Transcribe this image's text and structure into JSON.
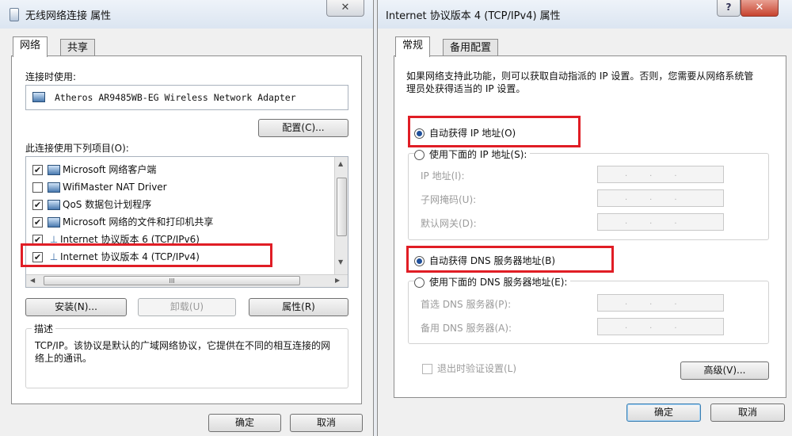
{
  "left_dialog": {
    "title": "无线网络连接 属性",
    "close": "✕",
    "tabs": [
      "网络",
      "共享"
    ],
    "connect_using_label": "连接时使用:",
    "adapter": "Atheros AR9485WB-EG Wireless Network Adapter",
    "configure_button": "配置(C)...",
    "items_label": "此连接使用下列项目(O):",
    "items": [
      {
        "label": "Microsoft 网络客户端",
        "checked": true
      },
      {
        "label": "WifiMaster NAT Driver",
        "checked": false
      },
      {
        "label": "QoS 数据包计划程序",
        "checked": true
      },
      {
        "label": "Microsoft 网络的文件和打印机共享",
        "checked": true
      },
      {
        "label": "Internet 协议版本 6 (TCP/IPv6)",
        "checked": true
      },
      {
        "label": "Internet 协议版本 4 (TCP/IPv4)",
        "checked": true
      }
    ],
    "check_mark": "✔",
    "scroll_grip": "III",
    "install_button": "安装(N)...",
    "uninstall_button": "卸载(U)",
    "properties_button": "属性(R)",
    "description_label": "描述",
    "description_text": "TCP/IP。该协议是默认的广域网络协议，它提供在不同的相互连接的网络上的通讯。",
    "ok_button": "确定",
    "cancel_button": "取消"
  },
  "right_dialog": {
    "title": "Internet 协议版本 4 (TCP/IPv4) 属性",
    "help": "?",
    "close": "✕",
    "tabs": [
      "常规",
      "备用配置"
    ],
    "intro_text": "如果网络支持此功能，则可以获取自动指派的 IP 设置。否则，您需要从网络系统管理员处获得适当的 IP 设置。",
    "auto_ip_option": "自动获得 IP 地址(O)",
    "manual_ip_option": "使用下面的 IP 地址(S):",
    "ip_address_label": "IP 地址(I):",
    "subnet_mask_label": "子网掩码(U):",
    "gateway_label": "默认网关(D):",
    "auto_dns_option": "自动获得 DNS 服务器地址(B)",
    "manual_dns_option": "使用下面的 DNS 服务器地址(E):",
    "preferred_dns_label": "首选 DNS 服务器(P):",
    "alternate_dns_label": "备用 DNS 服务器(A):",
    "ip_placeholder": "...",
    "validate_label": "退出时验证设置(L)",
    "advanced_button": "高级(V)...",
    "ok_button": "确定",
    "cancel_button": "取消"
  },
  "colors": {
    "highlight_box": "#e01d25",
    "title_gradient": "#dbe5f1",
    "window_bg": "#f0f0f0"
  }
}
